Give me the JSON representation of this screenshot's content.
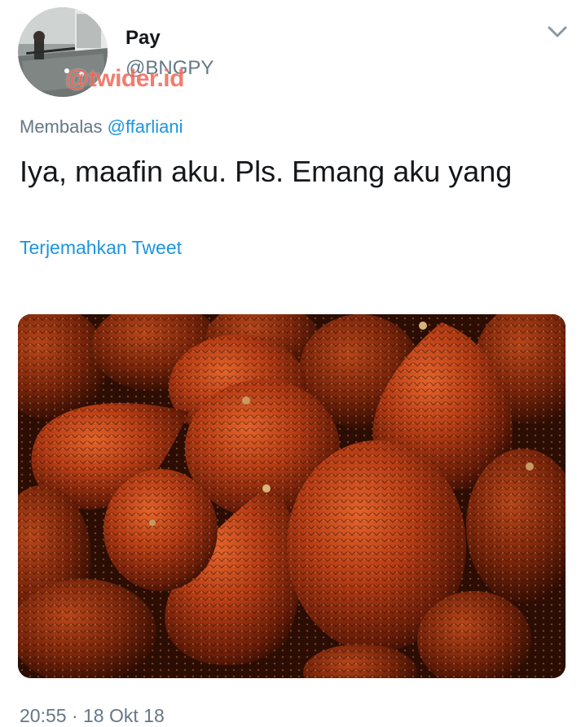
{
  "user": {
    "display_name": "Pay",
    "handle": "@BNGPY",
    "avatar_description": "person at pool table"
  },
  "watermark": "@twider.id",
  "reply": {
    "prefix": "Membalas",
    "mention": "@ffarliani"
  },
  "tweet": {
    "text": "Iya, maafin aku. Pls. Emang aku yang",
    "translate_label": "Terjemahkan Tweet",
    "media_description": "salak fruits (snake fruit)"
  },
  "footer": {
    "time": "20:55",
    "separator": "·",
    "date": "18 Okt 18"
  },
  "icons": {
    "menu": "chevron-down-icon"
  },
  "colors": {
    "link": "#1b95e0",
    "secondary_text": "#657786",
    "primary_text": "#14171a",
    "watermark": "#f26a5a"
  }
}
